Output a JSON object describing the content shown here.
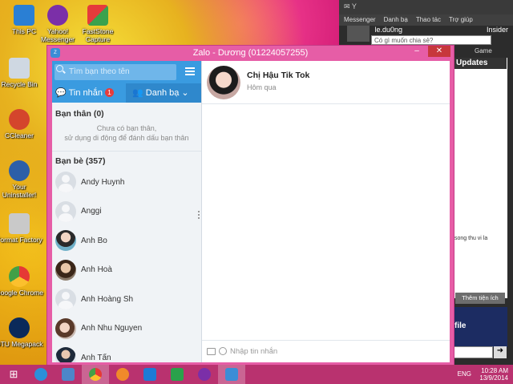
{
  "desktop": {
    "icons": [
      {
        "label": "This PC"
      },
      {
        "label": "Yahoo! Messenger"
      },
      {
        "label": "FastStone Capture"
      },
      {
        "label": "Recycle Bin"
      },
      {
        "label": "CCleaner"
      },
      {
        "label": "Your Uninstaller!"
      },
      {
        "label": "Format Factory"
      },
      {
        "label": "Google Chrome"
      },
      {
        "label": "DTU Megapack"
      }
    ]
  },
  "yahoo": {
    "menu": [
      "Messenger",
      "Danh bạ",
      "Thao tác",
      "Trợ giúp"
    ],
    "username": "le.du0ng",
    "status_placeholder": "Có gì muốn chia sẻ?",
    "insider": "Insider",
    "game": "Game",
    "updates": "Updates",
    "snippet": "song thu vi la",
    "add_button": "Thêm tiện ích",
    "ad_text": "file"
  },
  "zalo": {
    "title": "Zalo - Dương (01224057255)",
    "search_placeholder": "Tìm bạn theo tên",
    "tabs": {
      "messages_label": "Tin nhắn",
      "messages_badge": "1",
      "contacts_label": "Danh bạ"
    },
    "close_friends": {
      "header": "Bạn thân (0)",
      "empty_line1": "Chưa có bạn thân,",
      "empty_line2": "sử dụng di động để đánh dấu bạn thân"
    },
    "friends": {
      "header": "Bạn bè (357)",
      "items": [
        {
          "name": "Andy Huynh",
          "avatar": "generic"
        },
        {
          "name": "Anggi",
          "avatar": "generic"
        },
        {
          "name": "Anh Bo",
          "avatar": "photo"
        },
        {
          "name": "Anh Hoà",
          "avatar": "photo"
        },
        {
          "name": "Anh Hoàng Sh",
          "avatar": "generic"
        },
        {
          "name": "Anh Nhu Nguyen",
          "avatar": "photo"
        },
        {
          "name": "Anh Tấn",
          "avatar": "photo"
        }
      ]
    },
    "chat": {
      "contact_name": "Chị Hậu Tik Tok",
      "last_seen": "Hôm qua",
      "compose_placeholder": "Nhập tin nhắn"
    }
  },
  "taskbar": {
    "time": "10:28 AM",
    "date": "13/9/2014",
    "language": "ENG"
  },
  "colors": {
    "zalo_frame": "#e65da6",
    "zalo_header": "#3a9be0",
    "taskbar": "#b9326f"
  }
}
